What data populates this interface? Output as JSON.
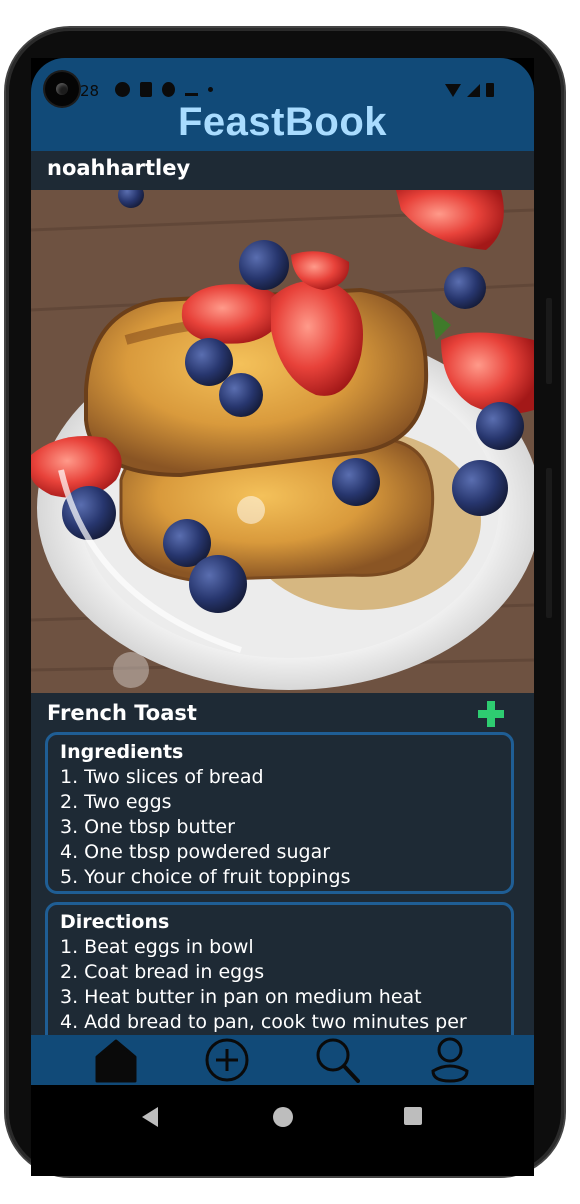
{
  "status_bar": {
    "time": "28",
    "icons": [
      "autofill-a-icon",
      "sd-card-icon",
      "bug-icon",
      "check-icon",
      "dot-icon"
    ],
    "system_icons": [
      "wifi-icon",
      "signal-icon",
      "battery-icon"
    ]
  },
  "header": {
    "app_title": "FeastBook",
    "username": "noahhartley"
  },
  "post": {
    "image_alt": "French toast with strawberries and blueberries",
    "title": "French Toast",
    "add_icon": "plus-icon"
  },
  "ingredients": {
    "title": "Ingredients",
    "items": [
      "1. Two slices of bread",
      "2. Two eggs",
      "3. One tbsp butter",
      "4. One tbsp powdered sugar",
      "5. Your choice of fruit toppings"
    ]
  },
  "directions": {
    "title": "Directions",
    "items": [
      "1. Beat eggs in bowl",
      "2. Coat bread in eggs",
      "3. Heat butter in pan on medium heat",
      "4. Add bread to pan, cook two minutes per"
    ]
  },
  "bottom_nav": {
    "items": [
      "home-icon",
      "add-circle-icon",
      "search-icon",
      "profile-icon"
    ]
  },
  "colors": {
    "header_bg": "#114a78",
    "title_text": "#a9dcff",
    "surface": "#1e2a35",
    "card_border": "#1f5e95",
    "add_green": "#2ecc71"
  }
}
